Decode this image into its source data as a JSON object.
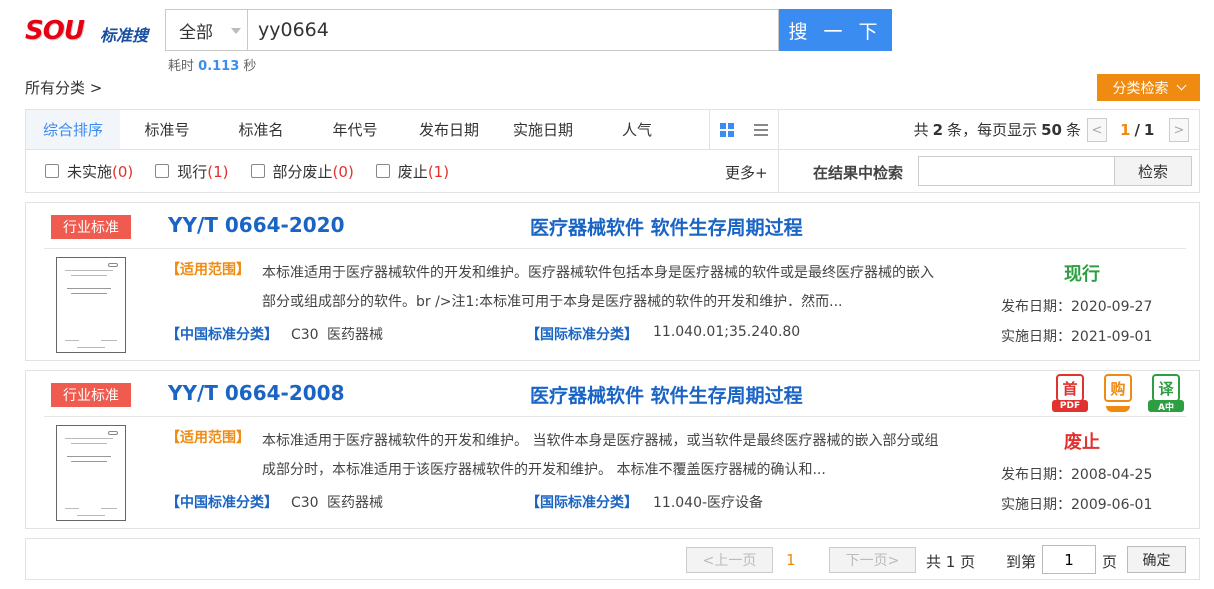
{
  "header": {
    "logo_text": "SOU",
    "logo_brand": "标准搜",
    "scope_value": "全部",
    "query": "yy0664",
    "search_button": "搜 一 下",
    "timing_prefix": "耗时",
    "timing_value": "0.113",
    "timing_unit": "秒"
  },
  "breadcrumb": {
    "all_categories": "所有分类 >"
  },
  "category_search_button": "分类检索",
  "sort": {
    "tabs": [
      "综合排序",
      "标准号",
      "标准名",
      "年代号",
      "发布日期",
      "实施日期",
      "人气"
    ],
    "active_index": 0
  },
  "pagination_info": {
    "prefix": "共",
    "total": "2",
    "mid": "条，每页显示",
    "per_page": "50",
    "suffix": "条",
    "prev": "<",
    "next": ">",
    "current": "1",
    "slash": "/",
    "total_pages": "1"
  },
  "filters": [
    {
      "label": "未实施",
      "count": "(0)"
    },
    {
      "label": "现行",
      "count": "(1)"
    },
    {
      "label": "部分废止",
      "count": "(0)"
    },
    {
      "label": "废止",
      "count": "(1)"
    }
  ],
  "more_label": "更多+",
  "in_results": {
    "label": "在结果中检索",
    "placeholder": "",
    "button": "检索"
  },
  "results": [
    {
      "badge": "行业标准",
      "std_no": "YY/T 0664-2020",
      "name": "医疗器械软件 软件生存周期过程",
      "scope_tag": "【适用范围】",
      "scope_text": "本标准适用于医疗器械软件的开发和维护。医疗器械软件包括本身是医疗器械的软件或是最终医疗器械的嵌入部分或组成部分的软件。br />注1:本标准可用于本身是医疗器械的软件的开发和维护．然而...",
      "cn_tag": "【中国标准分类】",
      "cn_value": "C30 医药器械",
      "intl_tag": "【国际标准分类】",
      "intl_value": "11.040.01;35.240.80",
      "status": "现行",
      "status_color": "#2e9e42",
      "pub_date": "发布日期：2020-09-27",
      "impl_date": "实施日期：2021-09-01"
    },
    {
      "badge": "行业标准",
      "std_no": "YY/T 0664-2008",
      "name": "医疗器械软件 软件生存周期过程",
      "scope_tag": "【适用范围】",
      "scope_text": "本标准适用于医疗器械软件的开发和维护。 当软件本身是医疗器械，或当软件是最终医疗器械的嵌入部分或组成部分时，本标准适用于该医疗器械软件的开发和维护。 本标准不覆盖医疗器械的确认和...",
      "cn_tag": "【中国标准分类】",
      "cn_value": "C30 医药器械",
      "intl_tag": "【国际标准分类】",
      "intl_value": "11.040-医疗设备",
      "status": "废止",
      "status_color": "#e0322f",
      "pub_date": "发布日期：2008-04-25",
      "impl_date": "实施日期：2009-06-01",
      "actions": [
        {
          "icon": "pdf-icon",
          "glyph": "首",
          "tag": "PDF",
          "color": "#e0322f"
        },
        {
          "icon": "buy-icon",
          "glyph": "购",
          "tag": "",
          "color": "#f08b12"
        },
        {
          "icon": "translate-icon",
          "glyph": "译",
          "tag": "A中",
          "color": "#2e9e42"
        }
      ]
    }
  ],
  "pager": {
    "prev": "<上一页",
    "current": "1",
    "next": "下一页>",
    "total_text": "共 1 页",
    "goto_label": "到第",
    "goto_value": "1",
    "page_unit": "页",
    "confirm": "确定"
  }
}
